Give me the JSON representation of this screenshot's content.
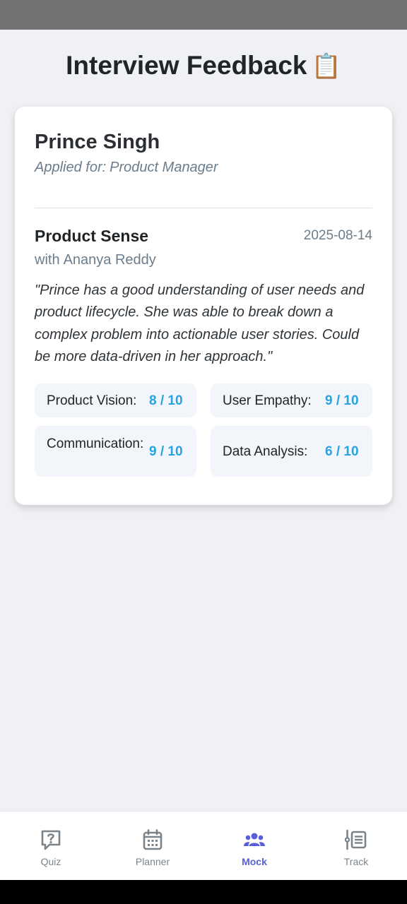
{
  "header": {
    "title": "Interview Feedback",
    "title_emoji": "📋"
  },
  "candidate": {
    "name": "Prince Singh",
    "applied_prefix": "Applied for:",
    "role": "Product Manager"
  },
  "round": {
    "name": "Product Sense",
    "date": "2025-08-14",
    "interviewer_prefix": "with",
    "interviewer": "Ananya Reddy",
    "feedback": "\"Prince has a good understanding of user needs and product lifecycle. She was able to break down a complex problem into actionable user stories. Could be more data-driven in her approach.\"",
    "scores": [
      {
        "label": "Product Vision:",
        "value": "8 / 10"
      },
      {
        "label": "User Empathy:",
        "value": "9 / 10"
      },
      {
        "label": "Communication:",
        "value": "9 / 10"
      },
      {
        "label": "Data Analysis:",
        "value": "6 / 10"
      }
    ]
  },
  "nav": {
    "active": "Mock",
    "items": [
      {
        "label": "Quiz",
        "icon": "quiz-icon"
      },
      {
        "label": "Planner",
        "icon": "calendar-icon"
      },
      {
        "label": "Mock",
        "icon": "people-icon"
      },
      {
        "label": "Track",
        "icon": "track-list-icon"
      }
    ]
  },
  "colors": {
    "accent": "#5a5fd6",
    "score": "#26a3e0",
    "muted": "#6b7d8c"
  }
}
